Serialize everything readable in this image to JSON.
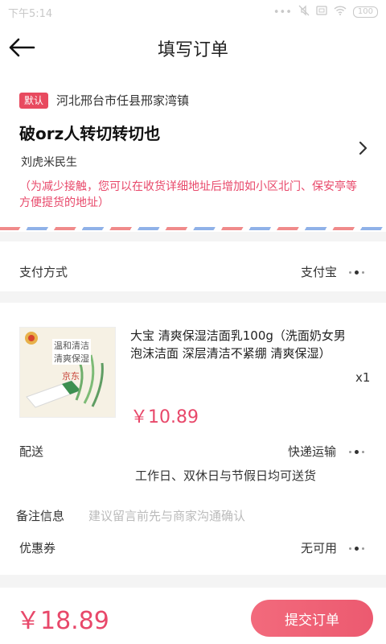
{
  "status_bar": {
    "time": "下午5:14",
    "battery": "100",
    "icons": [
      "dots-icon",
      "mute-icon",
      "sim-icon",
      "wifi-icon",
      "battery-icon"
    ]
  },
  "header": {
    "title": "填写订单",
    "back_icon": "arrow-left-icon"
  },
  "address": {
    "default_badge": "默认",
    "region": "河北邢台市任县邢家湾镇",
    "detail": "破orz人转切转切也",
    "receiver": "刘虎米民生",
    "tip": "（为减少接触，您可以在收货详细地址后增加如小区北门、保安亭等方便提货的地址）"
  },
  "payment": {
    "label": "支付方式",
    "value": "支付宝"
  },
  "product": {
    "image_text": [
      "温和清洁",
      "清爽保湿",
      "京东"
    ],
    "name": "大宝 清爽保湿洁面乳100g（洗面奶女男 泡沫洁面 深层清洁不紧绷 清爽保湿）",
    "quantity": "x1",
    "price": "￥10.89"
  },
  "delivery": {
    "label": "配送",
    "value": "快递运输",
    "note": "工作日、双休日与节假日均可送货"
  },
  "remark": {
    "label": "备注信息",
    "placeholder": "建议留言前先与商家沟通确认"
  },
  "coupon": {
    "label": "优惠券",
    "value": "无可用"
  },
  "footer": {
    "total": "￥18.89",
    "submit_label": "提交订单"
  },
  "colors": {
    "accent": "#e8486a",
    "badge": "#e84a5f",
    "page_background": "#f4f4f4"
  }
}
